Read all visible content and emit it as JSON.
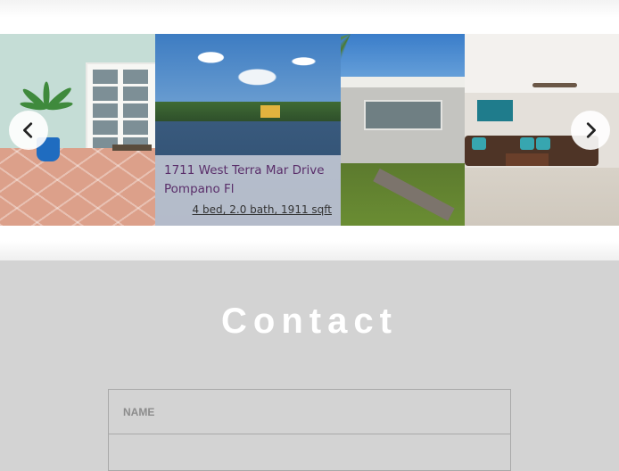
{
  "carousel": {
    "listing": {
      "address_line1": "1711 West Terra Mar Drive",
      "address_line2": "Pompano Fl",
      "details": "4 bed, 2.0 bath, 1911 sqft"
    },
    "prev_icon": "chevron-left-icon",
    "next_icon": "chevron-right-icon"
  },
  "contact": {
    "title": "Contact",
    "name_placeholder": "NAME"
  },
  "colors": {
    "section_bg": "#d3d3d3",
    "caption_text": "#5a2e6a",
    "title_text": "#ffffff"
  }
}
